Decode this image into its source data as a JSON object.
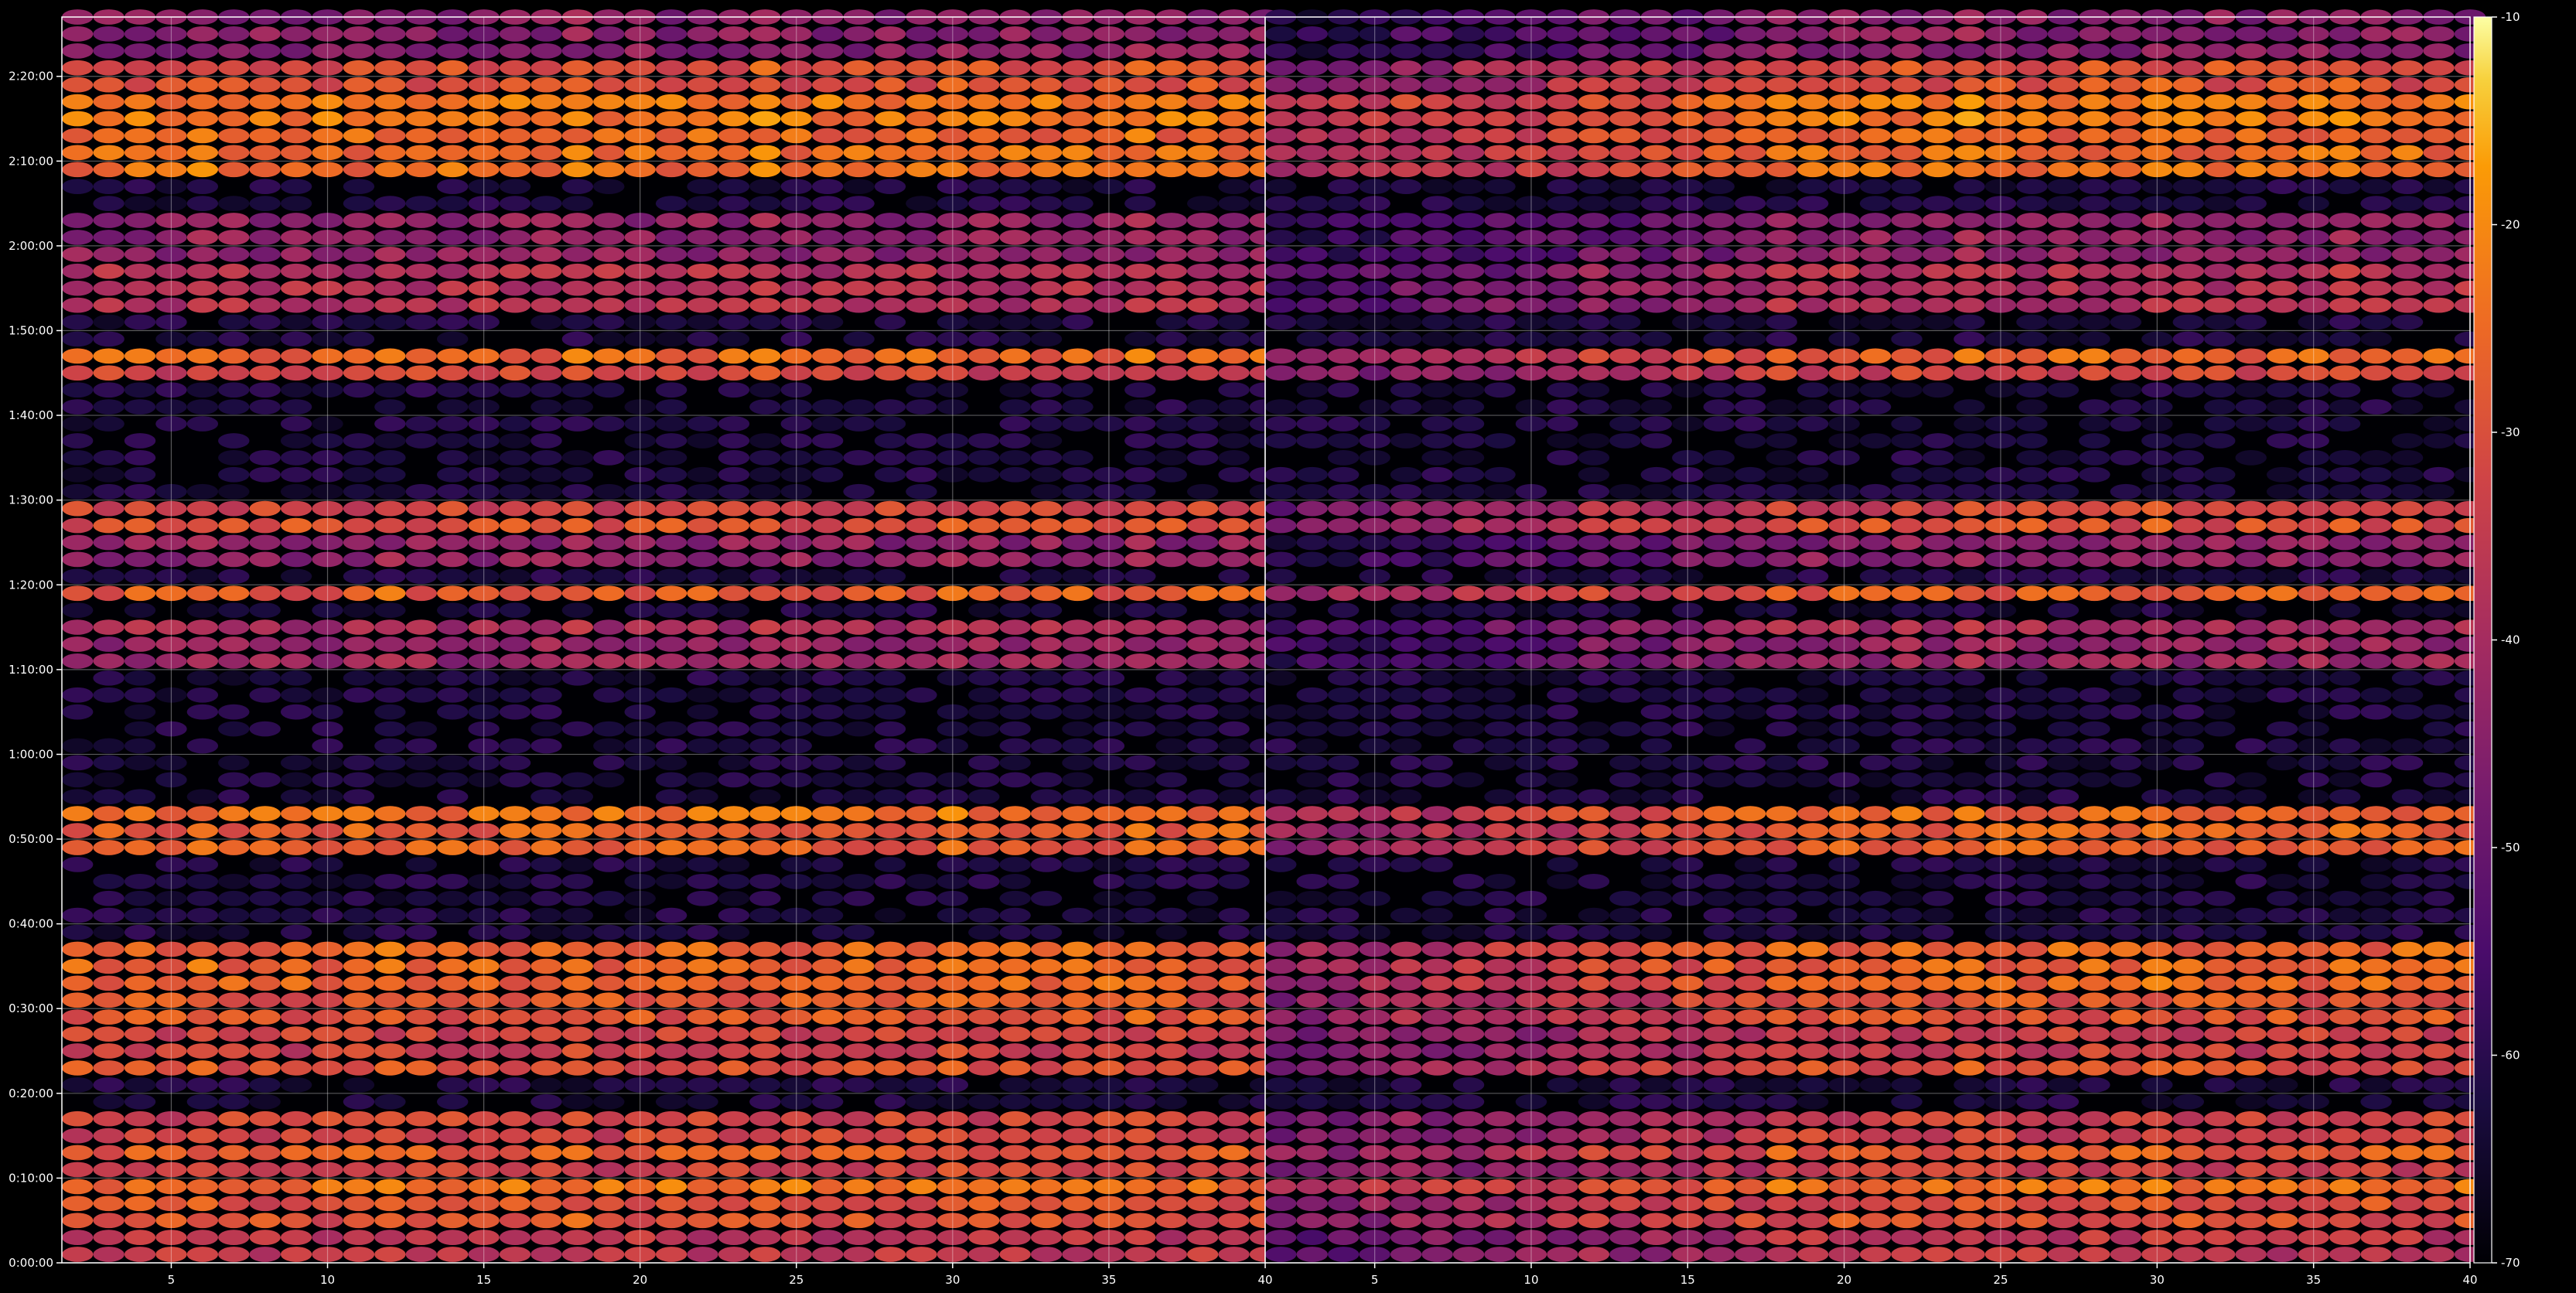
{
  "chart_data": {
    "type": "heatmap",
    "title": "",
    "xlabel": "",
    "ylabel": "",
    "colormap": "inferno",
    "background": "#000000",
    "grid": true,
    "panels": [
      {
        "name": "",
        "xlim": [
          1.5,
          40
        ],
        "x_ticks": [
          "5",
          "10",
          "15",
          "20",
          "25",
          "30",
          "35",
          "40"
        ],
        "x_tick_values": [
          5,
          10,
          15,
          20,
          25,
          30,
          35,
          40
        ],
        "x_columns": [
          2,
          40
        ],
        "bright_left": true
      },
      {
        "name": "",
        "xlim": [
          1.5,
          40
        ],
        "x_ticks": [
          "5",
          "10",
          "15",
          "20",
          "25",
          "30",
          "35",
          "40"
        ],
        "x_tick_values": [
          5,
          10,
          15,
          20,
          25,
          30,
          35,
          40
        ],
        "x_columns": [
          2,
          40
        ],
        "bright_left": false
      }
    ],
    "y": {
      "unit": "time",
      "ylim_minutes": [
        0,
        147
      ],
      "ticks": [
        "0:00:00",
        "0:10:00",
        "0:20:00",
        "0:30:00",
        "0:40:00",
        "0:50:00",
        "1:00:00",
        "1:10:00",
        "1:20:00",
        "1:30:00",
        "1:40:00",
        "1:50:00",
        "2:00:00",
        "2:10:00",
        "2:20:00"
      ],
      "tick_minutes": [
        0,
        10,
        20,
        30,
        40,
        50,
        60,
        70,
        80,
        90,
        100,
        110,
        120,
        130,
        140
      ]
    },
    "active_bands_minutes": [
      [
        0,
        3,
        -36
      ],
      [
        3,
        8,
        -30
      ],
      [
        8,
        10,
        -24
      ],
      [
        10,
        12,
        -34
      ],
      [
        12,
        14,
        -28
      ],
      [
        14,
        17,
        -33
      ],
      [
        21,
        23,
        -30
      ],
      [
        23,
        27,
        -34
      ],
      [
        27,
        32,
        -29
      ],
      [
        32,
        37,
        -26
      ],
      [
        39,
        40,
        -30
      ],
      [
        48,
        51,
        -27
      ],
      [
        51,
        53,
        -25
      ],
      [
        70,
        73,
        -42
      ],
      [
        73,
        76,
        -40
      ],
      [
        78,
        79,
        -28
      ],
      [
        82,
        86,
        -44
      ],
      [
        86,
        88,
        -30
      ],
      [
        88,
        90,
        -33
      ],
      [
        99,
        100,
        -28
      ],
      [
        103,
        105,
        -33
      ],
      [
        106,
        107,
        -26
      ],
      [
        111,
        117,
        -38
      ],
      [
        117,
        123,
        -44
      ],
      [
        128,
        131,
        -25
      ],
      [
        131,
        134,
        -26
      ],
      [
        134,
        137,
        -23
      ],
      [
        137,
        140,
        -30
      ],
      [
        140,
        142,
        -30
      ],
      [
        142,
        147,
        -45
      ]
    ],
    "colorbar": {
      "ticks": [
        "-10",
        "-20",
        "-30",
        "-40",
        "-50",
        "-60",
        "-70"
      ],
      "tick_values": [
        -10,
        -20,
        -30,
        -40,
        -50,
        -60,
        -70
      ],
      "range": [
        -70,
        -10
      ]
    }
  }
}
